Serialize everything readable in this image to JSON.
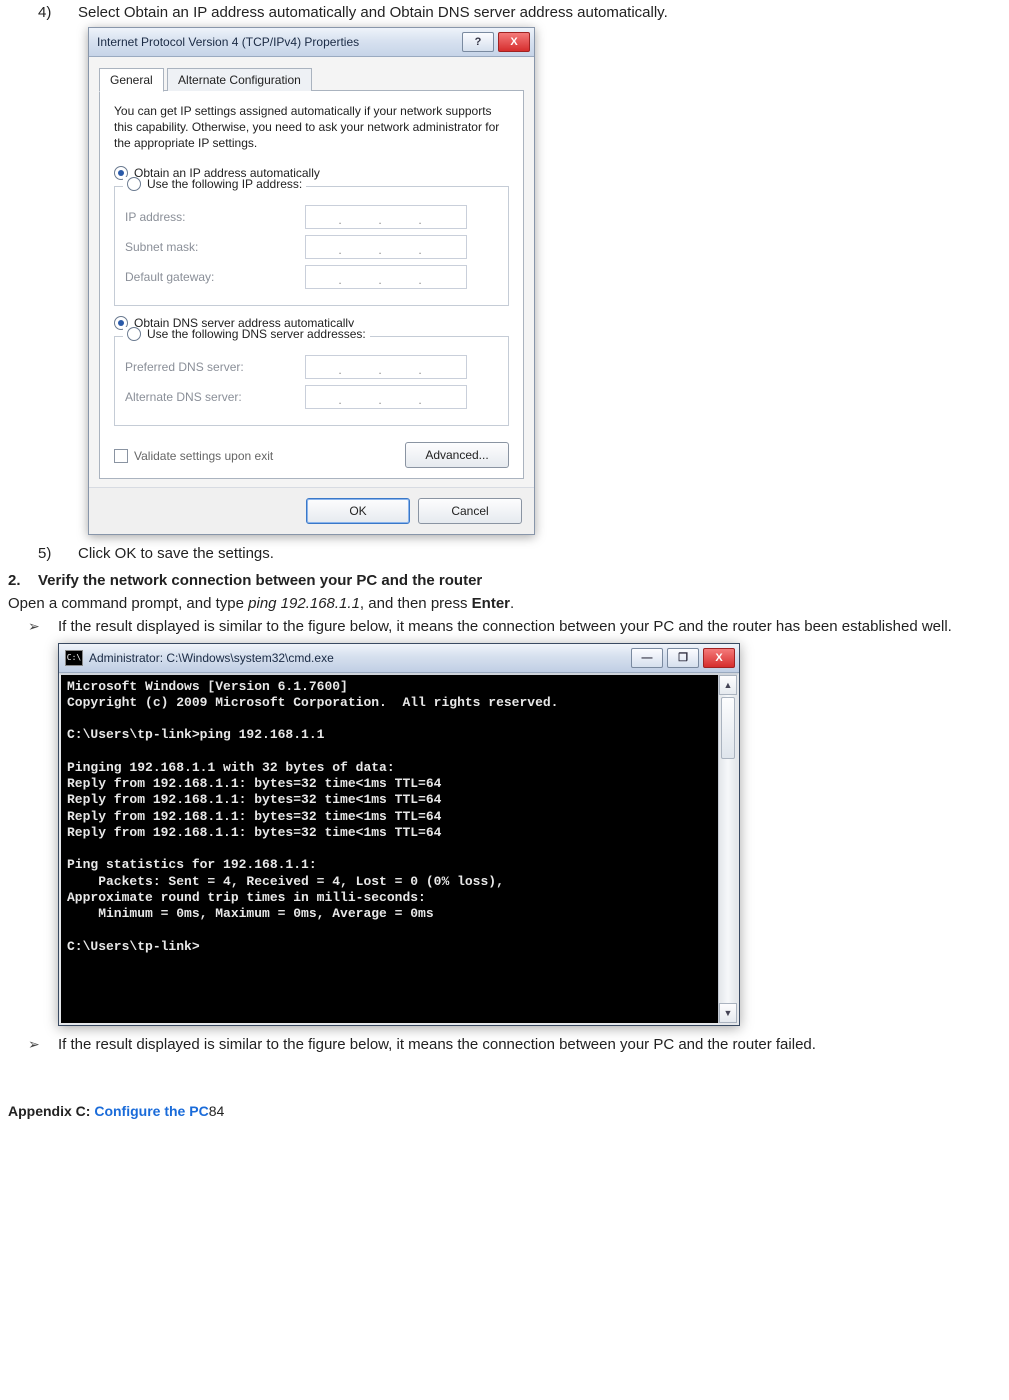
{
  "step4": {
    "num": "4)",
    "text": "Select Obtain an IP address automatically and Obtain DNS server address automatically."
  },
  "dialog": {
    "title": "Internet Protocol Version 4 (TCP/IPv4) Properties",
    "help": "?",
    "close": "X",
    "tabs": {
      "general": "General",
      "alt": "Alternate Configuration"
    },
    "desc": "You can get IP settings assigned automatically if your network supports this capability. Otherwise, you need to ask your network administrator for the appropriate IP settings.",
    "r1": "Obtain an IP address automatically",
    "r2": "Use the following IP address:",
    "f_ip": "IP address:",
    "f_mask": "Subnet mask:",
    "f_gw": "Default gateway:",
    "r3": "Obtain DNS server address automatically",
    "r4": "Use the following DNS server addresses:",
    "f_pdns": "Preferred DNS server:",
    "f_adns": "Alternate DNS server:",
    "validate": "Validate settings upon exit",
    "advanced": "Advanced...",
    "ok": "OK",
    "cancel": "Cancel"
  },
  "step5": {
    "num": "5)",
    "text": "Click OK to save the settings."
  },
  "h2": {
    "num": "2.",
    "text": "Verify the network connection between your PC and the router"
  },
  "open_para": {
    "a": "Open a command prompt, and type ",
    "b": "ping 192.168.1.1",
    "c": ", and then press ",
    "d": "Enter",
    "e": "."
  },
  "b1": "If the result displayed is similar to the figure below, it means the connection between your PC and the router has been established well.",
  "cmd": {
    "icon": "C:\\",
    "title": "Administrator: C:\\Windows\\system32\\cmd.exe",
    "min": "—",
    "max": "❐",
    "close": "X",
    "body": "Microsoft Windows [Version 6.1.7600]\nCopyright (c) 2009 Microsoft Corporation.  All rights reserved.\n\nC:\\Users\\tp-link>ping 192.168.1.1\n\nPinging 192.168.1.1 with 32 bytes of data:\nReply from 192.168.1.1: bytes=32 time<1ms TTL=64\nReply from 192.168.1.1: bytes=32 time<1ms TTL=64\nReply from 192.168.1.1: bytes=32 time<1ms TTL=64\nReply from 192.168.1.1: bytes=32 time<1ms TTL=64\n\nPing statistics for 192.168.1.1:\n    Packets: Sent = 4, Received = 4, Lost = 0 (0% loss),\nApproximate round trip times in milli-seconds:\n    Minimum = 0ms, Maximum = 0ms, Average = 0ms\n\nC:\\Users\\tp-link>"
  },
  "b2": "If the result displayed is similar to the figure below, it means the connection between your PC and the router failed.",
  "footer": {
    "a": "Appendix C: ",
    "b": "Configure the PC",
    "c": "84"
  }
}
